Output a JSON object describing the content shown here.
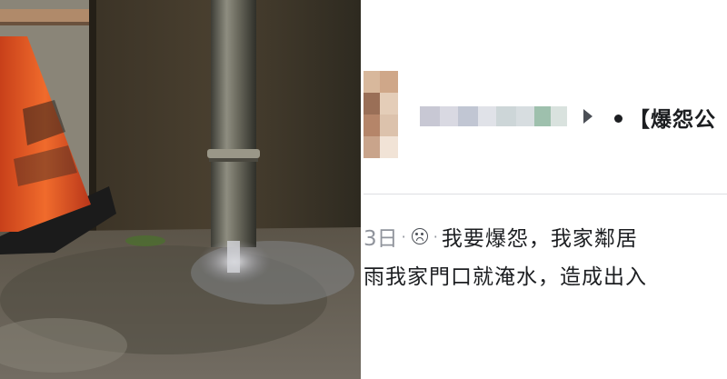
{
  "post": {
    "title": "●【爆怨公",
    "title_text": "【爆怨公",
    "date": "3日",
    "sep1": "·",
    "sep2": "·",
    "line1": "我要爆怨，我家鄰居",
    "line2": "雨我家門口就淹水，造成出入"
  },
  "icons": {
    "arrow": "triangle-right-icon",
    "privacy": "emoji-face-icon",
    "bullet": "bullet-dot-icon"
  },
  "colors": {
    "text": "#1c1e21",
    "meta": "#90949c",
    "separator": "#dddfe2"
  }
}
